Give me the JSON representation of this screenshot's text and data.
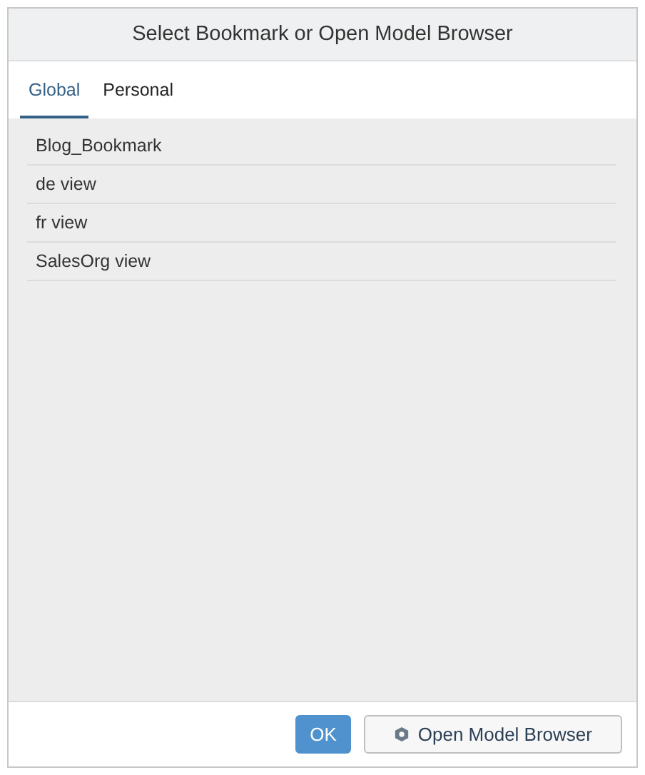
{
  "dialog": {
    "title": "Select Bookmark or Open Model Browser"
  },
  "tabs": [
    {
      "label": "Global",
      "selected": true
    },
    {
      "label": "Personal",
      "selected": false
    }
  ],
  "bookmarks": [
    "Blog_Bookmark",
    "de view",
    "fr view",
    "SalesOrg view"
  ],
  "buttons": [
    {
      "kind": "primary",
      "label": "OK"
    },
    {
      "kind": "secondary",
      "label": "Open Model Browser"
    }
  ]
}
